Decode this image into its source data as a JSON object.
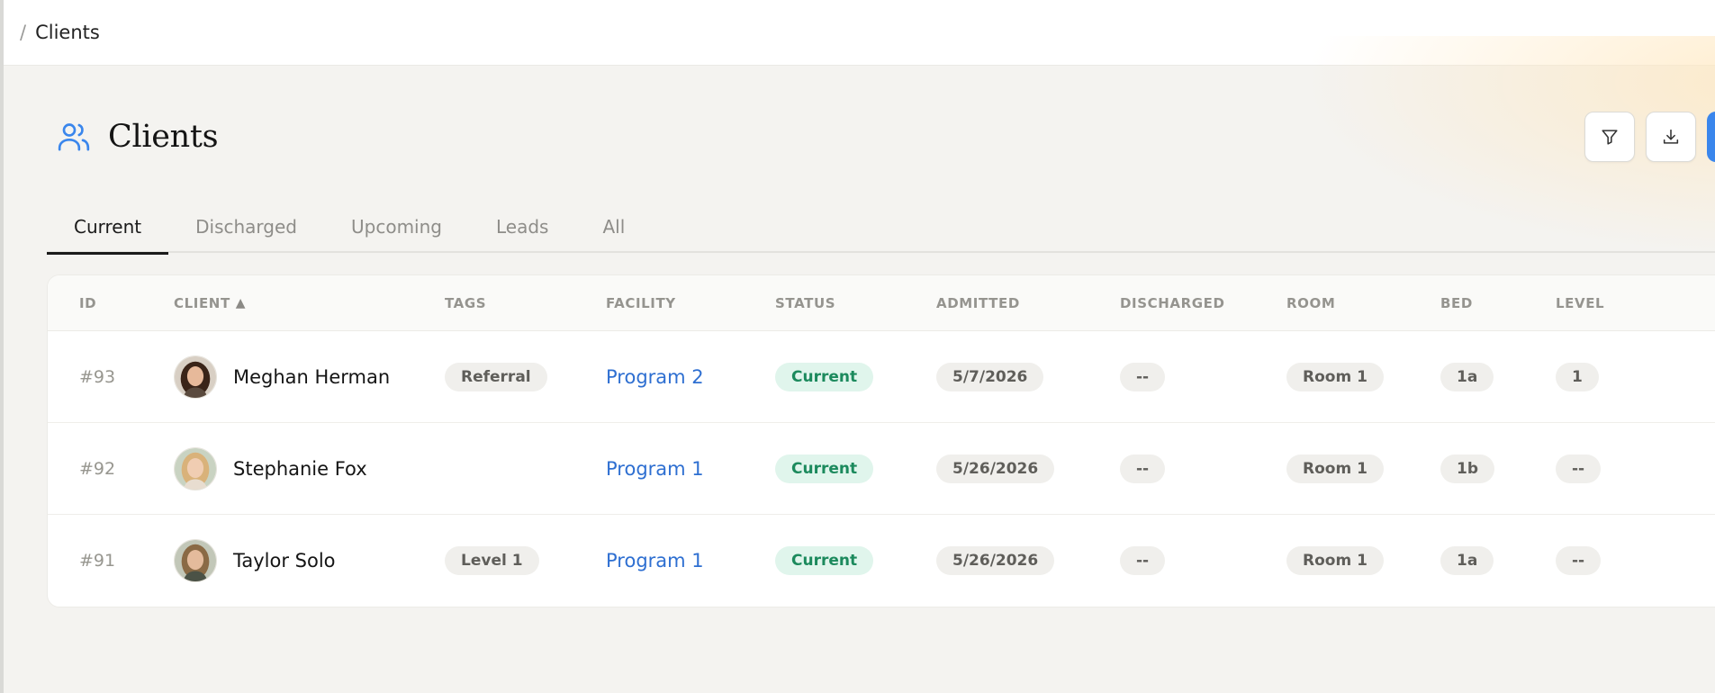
{
  "breadcrumb": {
    "separator": "/",
    "current": "Clients"
  },
  "page": {
    "title": "Clients",
    "icon": "users-icon"
  },
  "actions": {
    "filter_icon": "filter-icon",
    "download_icon": "download-icon"
  },
  "colors": {
    "accent": "#3a86ec",
    "link": "#2e6fd1",
    "status_bg": "#e0f5ec",
    "status_text": "#1c8a5d"
  },
  "tabs": [
    {
      "label": "Current",
      "active": true
    },
    {
      "label": "Discharged",
      "active": false
    },
    {
      "label": "Upcoming",
      "active": false
    },
    {
      "label": "Leads",
      "active": false
    },
    {
      "label": "All",
      "active": false
    }
  ],
  "table": {
    "columns": {
      "id": "ID",
      "client": "CLIENT",
      "tags": "TAGS",
      "facility": "FACILITY",
      "status": "STATUS",
      "admitted": "ADMITTED",
      "discharged": "DISCHARGED",
      "room": "ROOM",
      "bed": "BED",
      "level": "LEVEL"
    },
    "sort_indicator": "▲",
    "rows": [
      {
        "id": "#93",
        "name": "Meghan Herman",
        "tag": "Referral",
        "facility": "Program 2",
        "status": "Current",
        "admitted": "5/7/2026",
        "discharged": "--",
        "room": "Room 1",
        "bed": "1a",
        "level": "1"
      },
      {
        "id": "#92",
        "name": "Stephanie Fox",
        "tag": "",
        "facility": "Program 1",
        "status": "Current",
        "admitted": "5/26/2026",
        "discharged": "--",
        "room": "Room 1",
        "bed": "1b",
        "level": "--"
      },
      {
        "id": "#91",
        "name": "Taylor Solo",
        "tag": "Level 1",
        "facility": "Program 1",
        "status": "Current",
        "admitted": "5/26/2026",
        "discharged": "--",
        "room": "Room 1",
        "bed": "1a",
        "level": "--"
      }
    ]
  }
}
